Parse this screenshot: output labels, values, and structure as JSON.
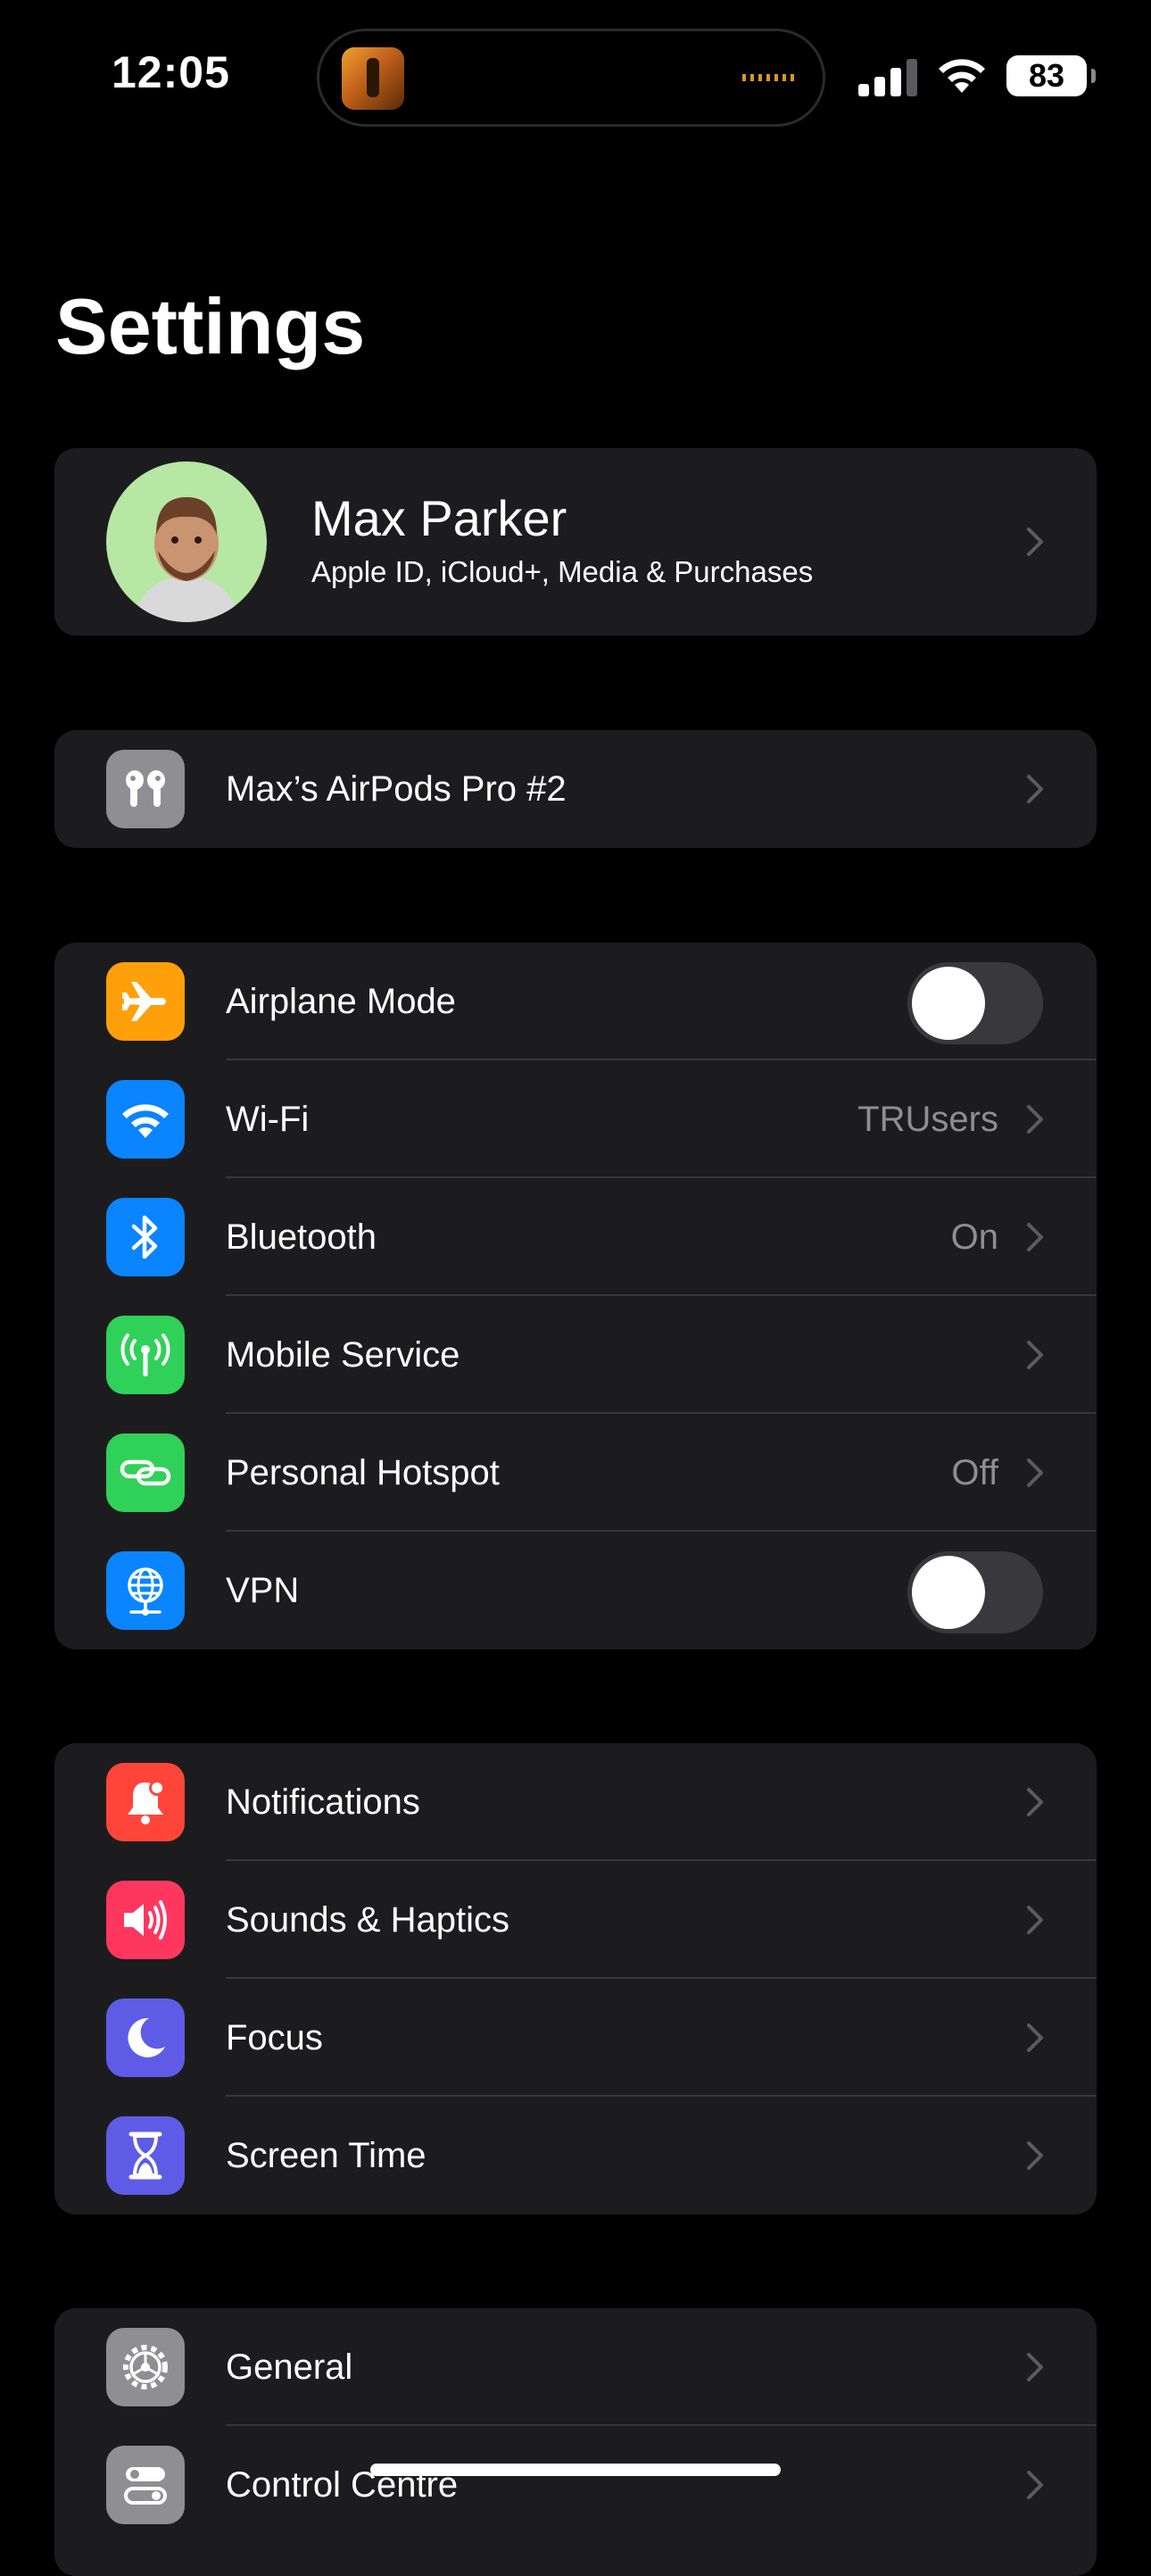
{
  "status_bar": {
    "time": "12:05",
    "battery": "83"
  },
  "title": "Settings",
  "profile": {
    "name": "Max Parker",
    "subtitle": "Apple ID, iCloud+, Media & Purchases"
  },
  "airpods": {
    "label": "Max’s AirPods Pro #2",
    "icon": "airpods-icon",
    "color": "#8e8e93"
  },
  "connectivity": [
    {
      "label": "Airplane Mode",
      "icon": "airplane-icon",
      "color": "#ff9f0a",
      "toggle": false
    },
    {
      "label": "Wi-Fi",
      "icon": "wifi-icon",
      "color": "#0a84ff",
      "value": "TRUsers"
    },
    {
      "label": "Bluetooth",
      "icon": "bluetooth-icon",
      "color": "#0a84ff",
      "value": "On"
    },
    {
      "label": "Mobile Service",
      "icon": "antenna-icon",
      "color": "#30d158",
      "value": ""
    },
    {
      "label": "Personal Hotspot",
      "icon": "hotspot-icon",
      "color": "#30d158",
      "value": "Off"
    },
    {
      "label": "VPN",
      "icon": "globe-icon",
      "color": "#0a84ff",
      "toggle": false
    }
  ],
  "alerts": [
    {
      "label": "Notifications",
      "icon": "bell-icon",
      "color": "#ff453a"
    },
    {
      "label": "Sounds & Haptics",
      "icon": "speaker-icon",
      "color": "#ff375f"
    },
    {
      "label": "Focus",
      "icon": "moon-icon",
      "color": "#5e5ce6"
    },
    {
      "label": "Screen Time",
      "icon": "hourglass-icon",
      "color": "#5e5ce6"
    }
  ],
  "general": [
    {
      "label": "General",
      "icon": "gear-icon",
      "color": "#8e8e93"
    },
    {
      "label": "Control Centre",
      "icon": "control-centre-icon",
      "color": "#8e8e93"
    }
  ]
}
